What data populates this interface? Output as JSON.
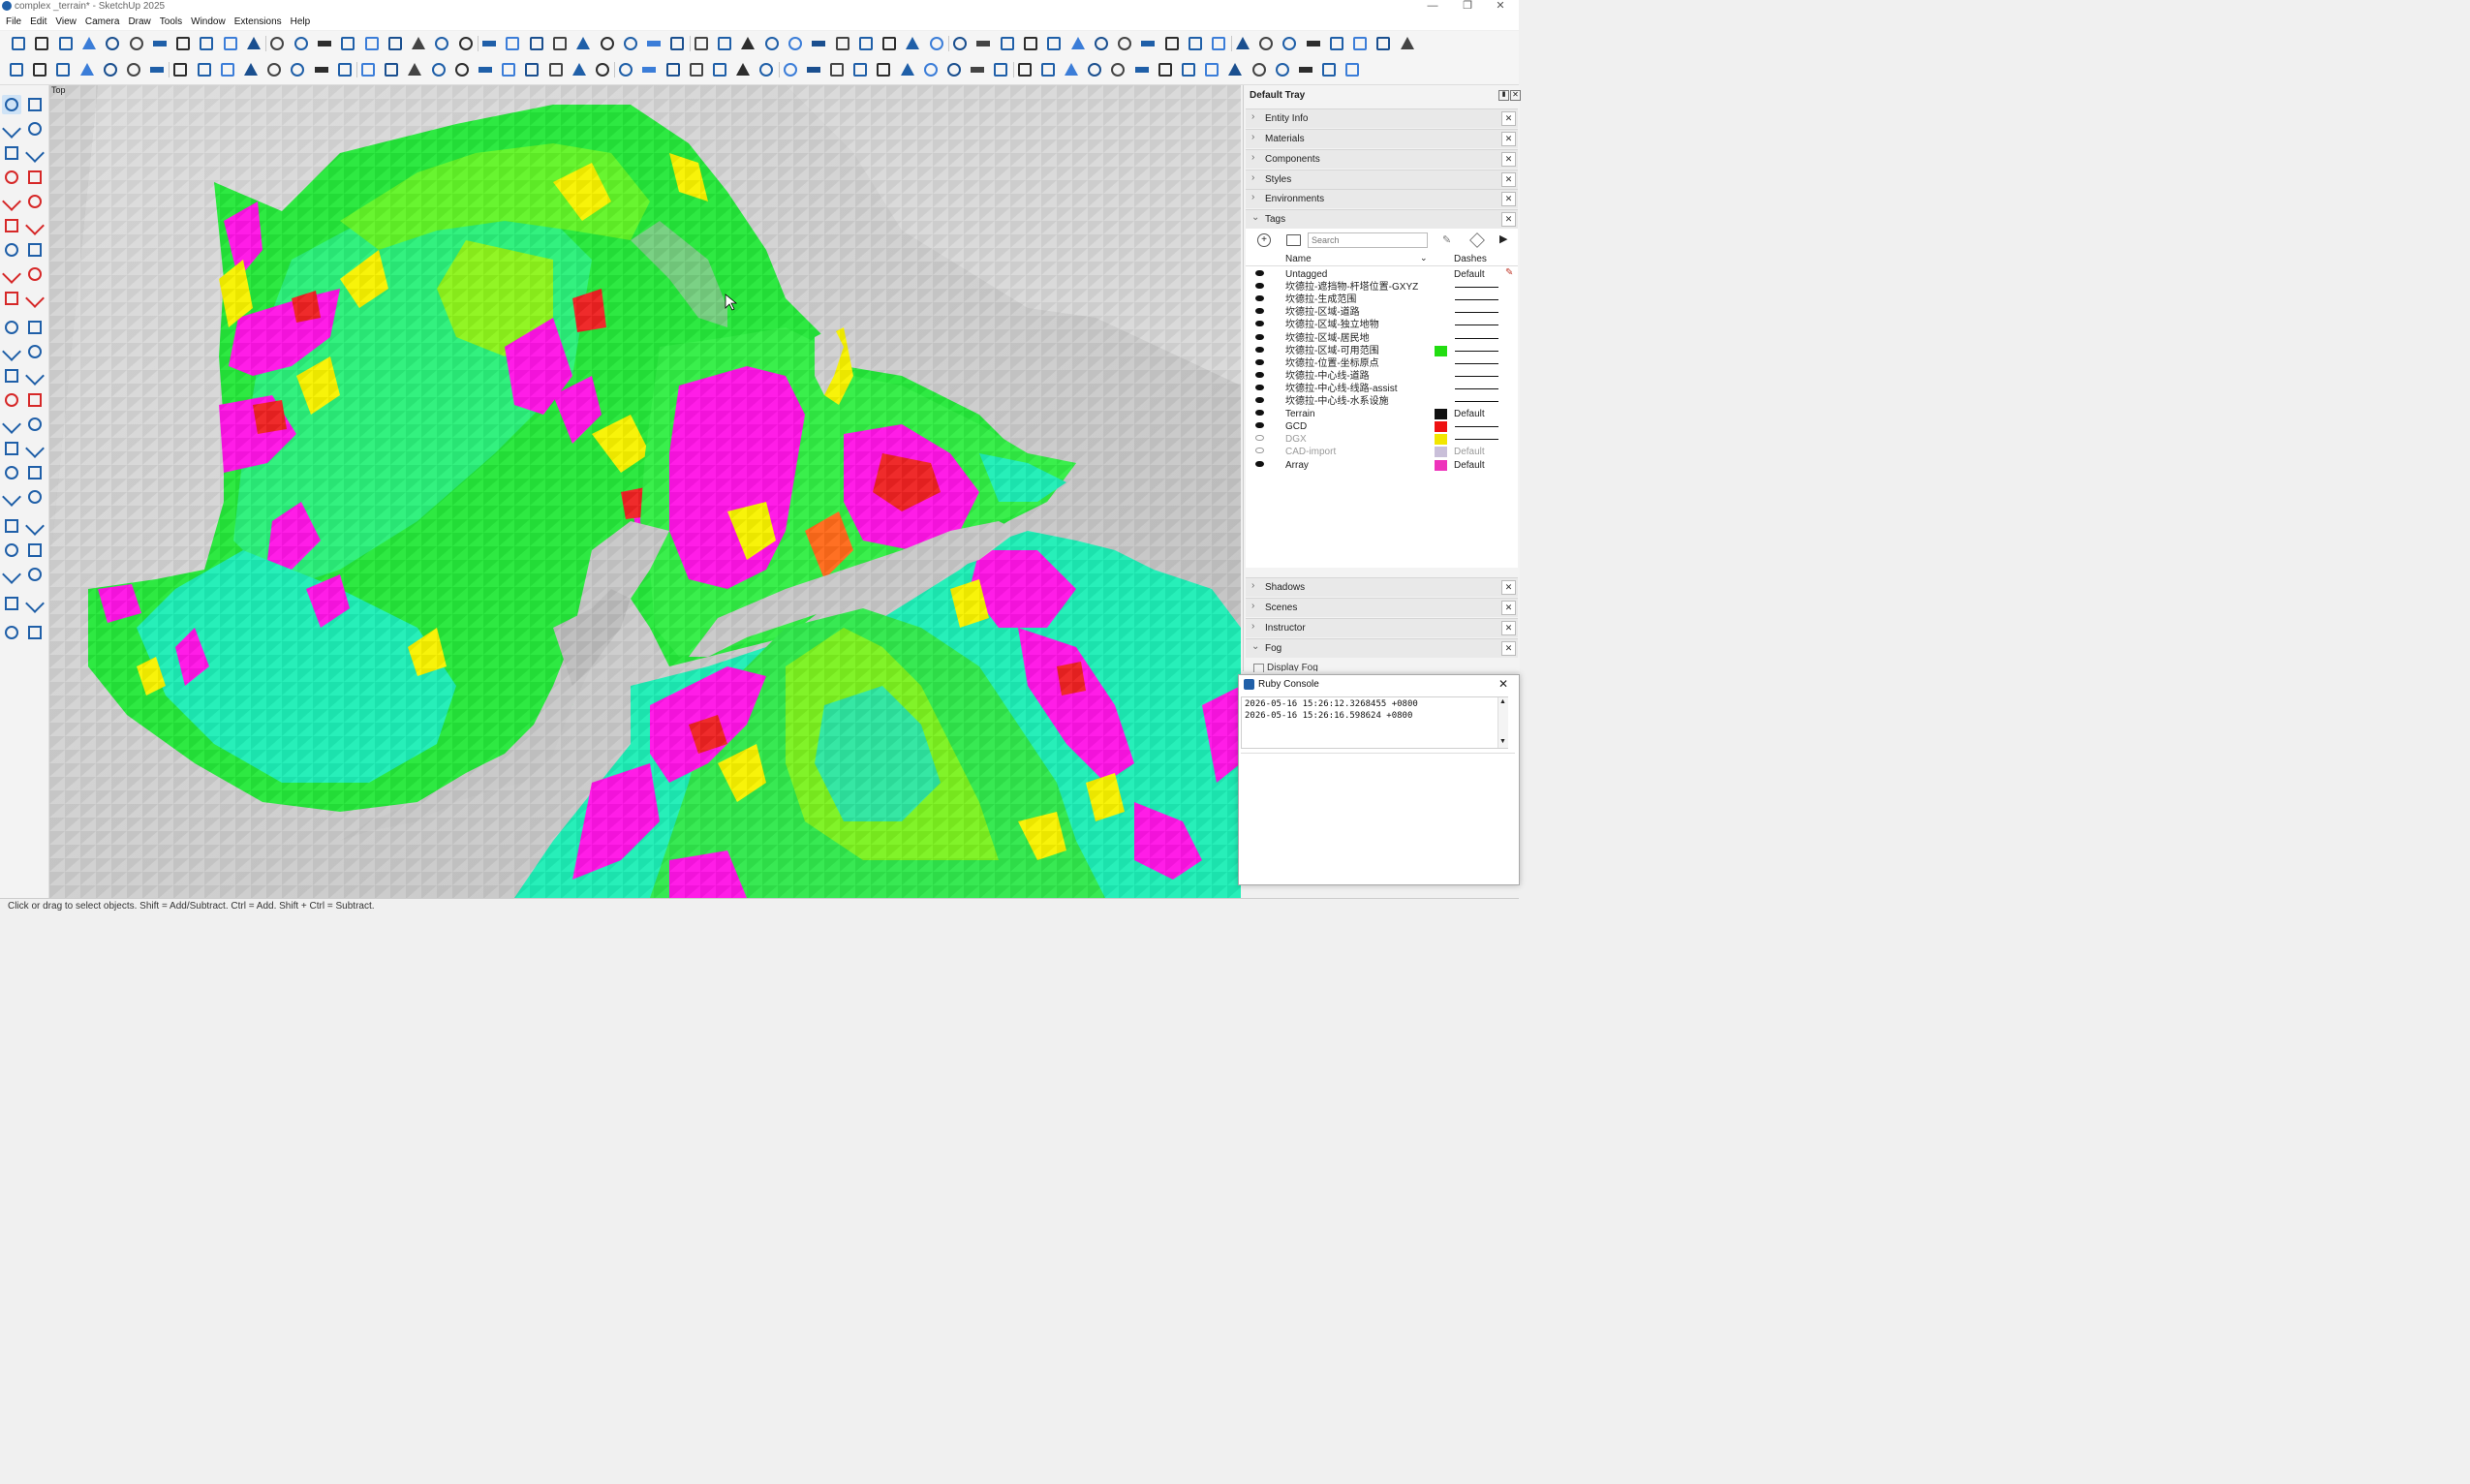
{
  "window": {
    "title": "complex _terrain* - SketchUp 2025",
    "controls": [
      "—",
      "❐",
      "✕"
    ]
  },
  "menu": [
    "File",
    "Edit",
    "View",
    "Camera",
    "Draw",
    "Tools",
    "Window",
    "Extensions",
    "Help"
  ],
  "viewport": {
    "view_name": "Top"
  },
  "status": {
    "text": "Click or drag to select objects. Shift = Add/Subtract. Ctrl = Add. Shift + Ctrl = Subtract."
  },
  "tray": {
    "title": "Default Tray",
    "panels_top": [
      "Entity Info",
      "Materials",
      "Components",
      "Styles",
      "Environments"
    ],
    "tags_panel": "Tags",
    "search_placeholder": "Search",
    "col_name": "Name",
    "col_dashes": "Dashes",
    "tags": [
      {
        "name": "Untagged",
        "material": "Default",
        "visible": true,
        "color": "",
        "dashes": false
      },
      {
        "name": "坎德拉-遮挡物-杆塔位置-GXYZ",
        "material": "",
        "visible": true,
        "color": "",
        "dashes": true
      },
      {
        "name": "坎德拉-生成范围",
        "material": "",
        "visible": true,
        "color": "",
        "dashes": true
      },
      {
        "name": "坎德拉-区域-道路",
        "material": "",
        "visible": true,
        "color": "",
        "dashes": true
      },
      {
        "name": "坎德拉-区域-独立地物",
        "material": "",
        "visible": true,
        "color": "",
        "dashes": true
      },
      {
        "name": "坎德拉-区域-居民地",
        "material": "",
        "visible": true,
        "color": "",
        "dashes": true
      },
      {
        "name": "坎德拉-区域-可用范围",
        "material": "",
        "visible": true,
        "color": "#22dd11",
        "dashes": true
      },
      {
        "name": "坎德拉-位置-坐标原点",
        "material": "",
        "visible": true,
        "color": "",
        "dashes": true
      },
      {
        "name": "坎德拉-中心线-道路",
        "material": "",
        "visible": true,
        "color": "",
        "dashes": true
      },
      {
        "name": "坎德拉-中心线-线路-assist",
        "material": "",
        "visible": true,
        "color": "",
        "dashes": true
      },
      {
        "name": "坎德拉-中心线-水系设施",
        "material": "",
        "visible": true,
        "color": "",
        "dashes": true
      },
      {
        "name": "Terrain",
        "material": "Default",
        "visible": true,
        "color": "#111111",
        "dashes": false
      },
      {
        "name": "GCD",
        "material": "",
        "visible": true,
        "color": "#ee1111",
        "dashes": true
      },
      {
        "name": "DGX",
        "material": "",
        "visible": false,
        "color": "#f2e600",
        "dashes": true
      },
      {
        "name": "CAD-import",
        "material": "Default",
        "visible": false,
        "color": "#c9bfd9",
        "dashes": false
      },
      {
        "name": "Array",
        "material": "Default",
        "visible": true,
        "color": "#ee33bb",
        "dashes": false
      }
    ],
    "panels_bottom": [
      "Shadows",
      "Scenes",
      "Instructor",
      "Fog"
    ],
    "fog_option": "Display Fog"
  },
  "ruby_console": {
    "title": "Ruby Console",
    "lines": [
      "2026-05-16 15:26:12.3268455 +0800",
      "2026-05-16 15:26:16.598624 +0800"
    ]
  },
  "colors": {
    "accent": "#1f5fa8",
    "terrain_green": "#22ee22",
    "terrain_cyan": "#1df0b0",
    "terrain_magenta": "#ff10e8",
    "terrain_yellow": "#f8f200",
    "terrain_red": "#ee2222"
  }
}
